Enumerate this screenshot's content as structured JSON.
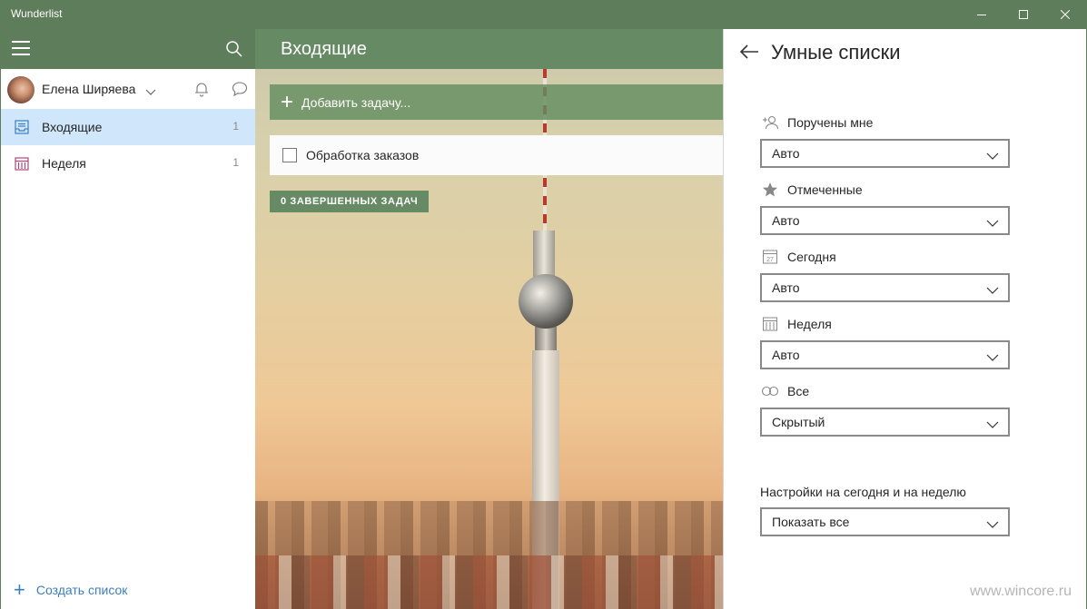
{
  "window": {
    "title": "Wunderlist"
  },
  "sidebar": {
    "user_name": "Елена Ширяева",
    "items": [
      {
        "label": "Входящие",
        "count": "1"
      },
      {
        "label": "Неделя",
        "count": "1"
      }
    ],
    "create_list": "Создать список"
  },
  "main": {
    "title": "Входящие",
    "add_task_placeholder": "Добавить задачу...",
    "tasks": [
      {
        "title": "Обработка заказов"
      }
    ],
    "completed_label": "0 ЗАВЕРШЕННЫХ ЗАДАЧ"
  },
  "smart_lists": {
    "title": "Умные списки",
    "options": [
      {
        "label": "Поручены мне",
        "icon": "assigned-icon",
        "value": "Авто"
      },
      {
        "label": "Отмеченные",
        "icon": "star-icon",
        "value": "Авто"
      },
      {
        "label": "Сегодня",
        "icon": "calendar-today-icon",
        "value": "Авто"
      },
      {
        "label": "Неделя",
        "icon": "calendar-week-icon",
        "value": "Авто"
      },
      {
        "label": "Все",
        "icon": "infinity-icon",
        "value": "Скрытый"
      }
    ],
    "today_week_label": "Настройки на сегодня и на неделю",
    "today_week_value": "Показать все"
  },
  "watermark": "www.wincore.ru",
  "colors": {
    "accent_green": "#5e7d5a",
    "selected_blue": "#cfe6fb",
    "link_blue": "#3b7ec0"
  }
}
